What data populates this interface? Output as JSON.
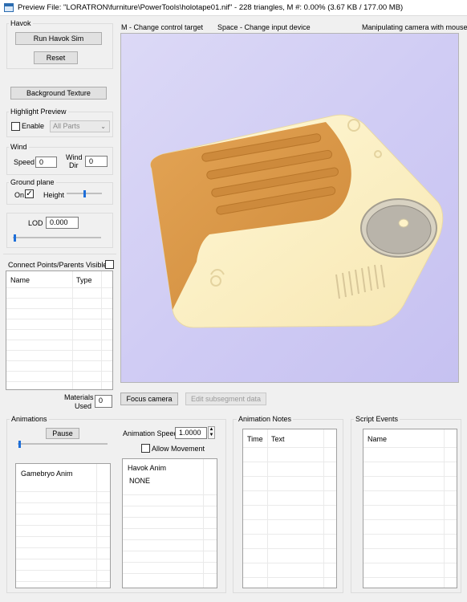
{
  "window": {
    "title": "Preview File: \"LORATRON\\furniture\\PowerTools\\holotape01.nif\" - 228 triangles, M #: 0.00% (3.67 KB / 177.00 MB)"
  },
  "havok": {
    "group_title": "Havok",
    "run_label": "Run Havok Sim",
    "reset_label": "Reset"
  },
  "background_texture_label": "Background Texture",
  "highlight_preview": {
    "group_title": "Highlight Preview",
    "enable_label": "Enable",
    "enable_checked": false,
    "select_value": "All Parts"
  },
  "wind": {
    "group_title": "Wind",
    "speed_label": "Speed",
    "speed_value": "0",
    "dir_label_1": "Wind",
    "dir_label_2": "Dir",
    "dir_value": "0"
  },
  "ground_plane": {
    "group_title": "Ground plane",
    "on_label": "On",
    "on_checked": true,
    "height_label": "Height",
    "height_level": 0.5
  },
  "lod": {
    "label": "LOD",
    "value": "0.000",
    "level": 0.0
  },
  "connect_points": {
    "title": "Connect Points/Parents",
    "visible_label": "Visible",
    "visible_checked": false,
    "columns": [
      "Name",
      "Type"
    ]
  },
  "materials": {
    "label_1": "Materials",
    "label_2": "Used",
    "value": "0"
  },
  "viewport_hints": {
    "left": "M - Change control target",
    "center": "Space - Change input device",
    "right": "Manipulating camera with mouse"
  },
  "buttons": {
    "focus_camera": "Focus camera",
    "edit_subsegment": "Edit subsegment data"
  },
  "animations": {
    "group_title": "Animations",
    "pause_label": "Pause",
    "speed_label": "Animation Speed",
    "speed_value": "1.0000",
    "allow_movement_label": "Allow Movement",
    "allow_movement_checked": false,
    "gamebryo_header": "Gamebryo Anim",
    "havok_header": "Havok Anim",
    "havok_items": [
      "NONE"
    ]
  },
  "animation_notes": {
    "group_title": "Animation Notes",
    "columns": [
      "Time",
      "Text"
    ]
  },
  "script_events": {
    "group_title": "Script Events",
    "columns": [
      "Name"
    ]
  },
  "colors": {
    "accent": "#1e6fd9",
    "viewport_bg": "#d0ccf4",
    "model_orange": "#d9913f",
    "model_cream": "#fbeec2"
  },
  "icons": [
    "app-icon",
    "checkmark-icon",
    "chevron-down-icon",
    "spin-up-icon",
    "spin-down-icon"
  ]
}
